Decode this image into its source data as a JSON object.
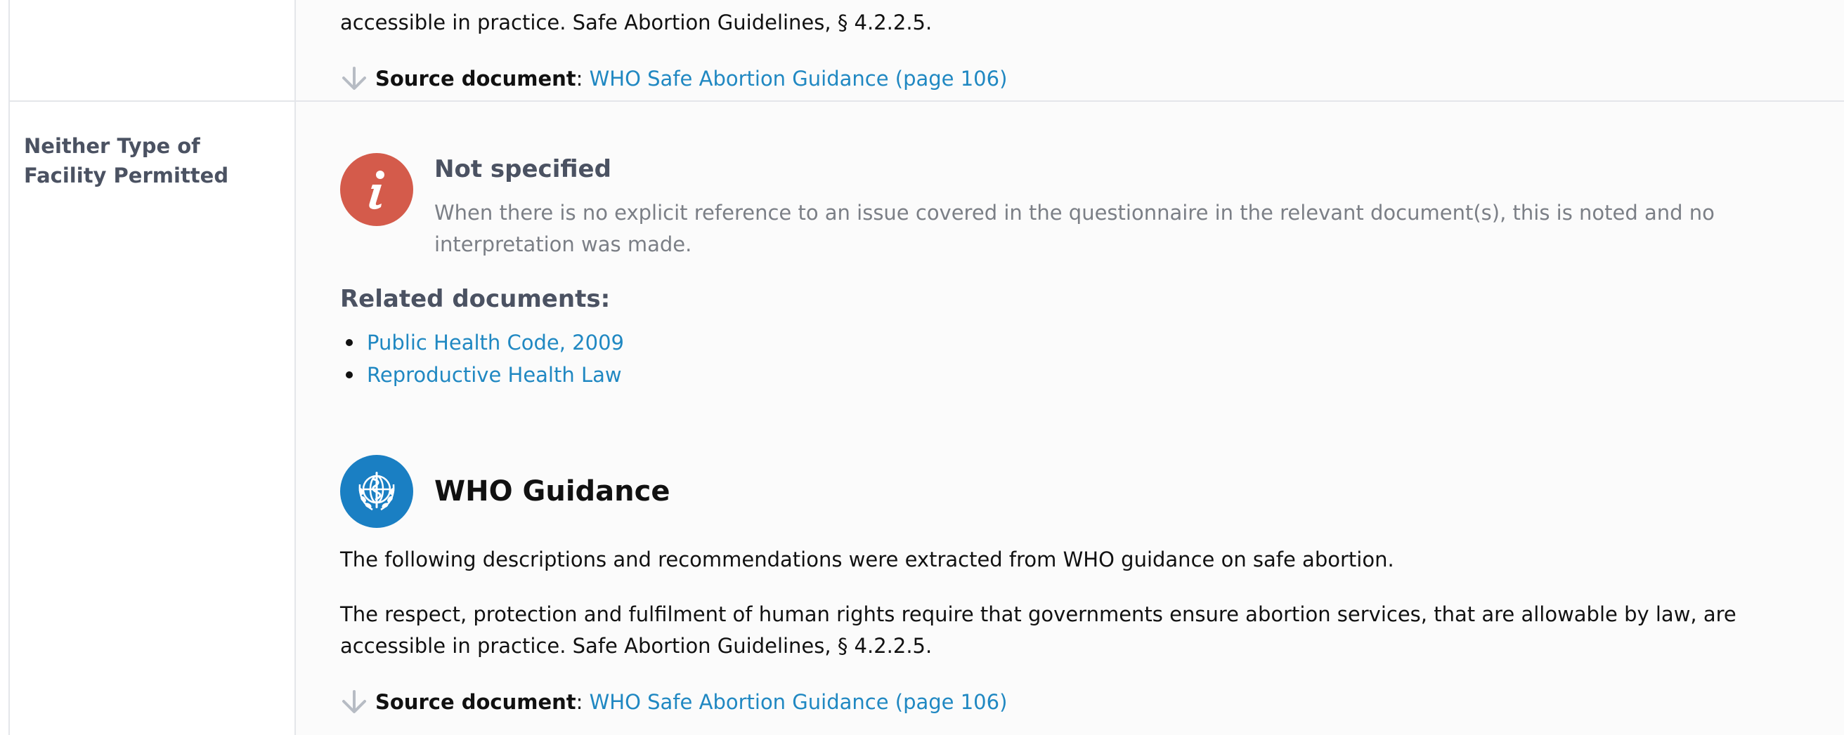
{
  "top_section": {
    "text_tail": "accessible in practice. Safe Abortion Guidelines, § 4.2.2.5.",
    "source": {
      "label": "Source document",
      "sep": ":",
      "link": "WHO Safe Abortion Guidance (page 106)"
    }
  },
  "row": {
    "label": "Neither Type of Facility Permitted",
    "status": {
      "icon": "info-icon",
      "icon_color": "#d45b4b",
      "title": "Not specified",
      "description": "When there is no explicit reference to an issue covered in the questionnaire in the relevant document(s), this is noted and no interpretation was made."
    },
    "related": {
      "heading": "Related documents:",
      "items": [
        "Public Health Code, 2009",
        "Reproductive Health Law"
      ]
    },
    "who": {
      "icon": "who-emblem-icon",
      "icon_color": "#1a7fc3",
      "title": "WHO Guidance",
      "intro": "The following descriptions and recommendations were extracted from WHO guidance on safe abortion.",
      "body": "The respect, protection and fulfilment of human rights require that governments ensure abortion services, that are allowable by law, are accessible in practice. Safe Abortion Guidelines, § 4.2.2.5.",
      "source": {
        "label": "Source document",
        "sep": ":",
        "link": "WHO Safe Abortion Guidance (page 106)"
      }
    }
  },
  "colors": {
    "link": "#2088c2",
    "label": "#4b5262",
    "muted": "#7b7f86"
  }
}
